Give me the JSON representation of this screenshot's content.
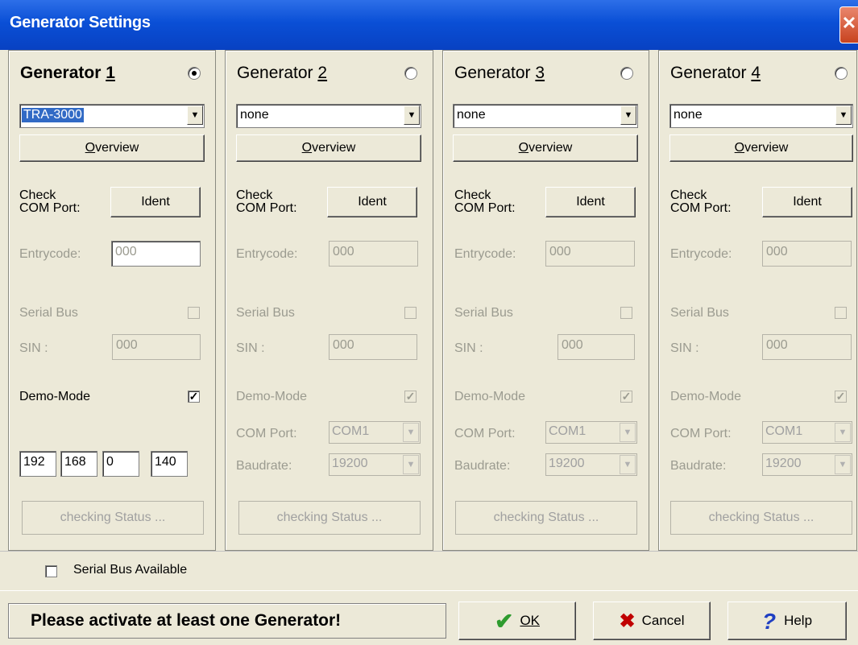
{
  "window": {
    "title": "Generator Settings",
    "close_label": "✕"
  },
  "generators": [
    {
      "title": "Generator ",
      "number": "1",
      "selected": true,
      "device": "TRA-3000",
      "overview_label": "Overview",
      "overview_hotkey": "O",
      "check_line1": "Check",
      "check_line2": "COM Port:",
      "ident_label": "Ident",
      "entrycode_label": "Entrycode:",
      "entrycode_value": "000",
      "serial_bus_label": "Serial Bus",
      "sin_label": "SIN :",
      "sin_value": "000",
      "demo_label": "Demo-Mode",
      "demo_checked": true,
      "ip": [
        "192",
        "168",
        "0",
        "140"
      ],
      "status_label": "checking Status ..."
    },
    {
      "title": "Generator ",
      "number": "2",
      "selected": false,
      "device": "none",
      "overview_label": "Overview",
      "check_line1": "Check",
      "check_line2": "COM Port:",
      "ident_label": "Ident",
      "entrycode_label": "Entrycode:",
      "entrycode_value": "000",
      "serial_bus_label": "Serial Bus",
      "sin_label": "SIN :",
      "sin_value": "000",
      "demo_label": "Demo-Mode",
      "demo_checked": true,
      "com_port_label": "COM Port:",
      "com_port_value": "COM1",
      "baudrate_label": "Baudrate:",
      "baudrate_value": "19200",
      "status_label": "checking Status ..."
    },
    {
      "title": "Generator ",
      "number": "3",
      "selected": false,
      "device": "none",
      "overview_label": "Overview",
      "check_line1": "Check",
      "check_line2": "COM Port:",
      "ident_label": "Ident",
      "entrycode_label": "Entrycode:",
      "entrycode_value": "000",
      "serial_bus_label": "Serial Bus",
      "sin_label": "SIN :",
      "sin_value": "000",
      "demo_label": "Demo-Mode",
      "demo_checked": true,
      "com_port_label": "COM Port:",
      "com_port_value": "COM1",
      "baudrate_label": "Baudrate:",
      "baudrate_value": "19200",
      "status_label": "checking Status ..."
    },
    {
      "title": "Generator ",
      "number": "4",
      "selected": false,
      "device": "none",
      "overview_label": "Overview",
      "check_line1": "Check",
      "check_line2": "COM Port:",
      "ident_label": "Ident",
      "entrycode_label": "Entrycode:",
      "entrycode_value": "000",
      "serial_bus_label": "Serial Bus",
      "sin_label": "SIN :",
      "sin_value": "000",
      "demo_label": "Demo-Mode",
      "demo_checked": true,
      "com_port_label": "COM Port:",
      "com_port_value": "COM1",
      "baudrate_label": "Baudrate:",
      "baudrate_value": "19200",
      "status_label": "checking Status ..."
    }
  ],
  "serial_bus_available_label": "Serial Bus Available",
  "status_message": "Please activate at least one Generator!",
  "buttons": {
    "ok": "OK",
    "cancel": "Cancel",
    "help": "Help"
  },
  "colors": {
    "titlebar": "#0a4fd6",
    "ok_check": "#2e9b2e",
    "cancel_x": "#c00000",
    "help_q": "#1f3fc2"
  }
}
